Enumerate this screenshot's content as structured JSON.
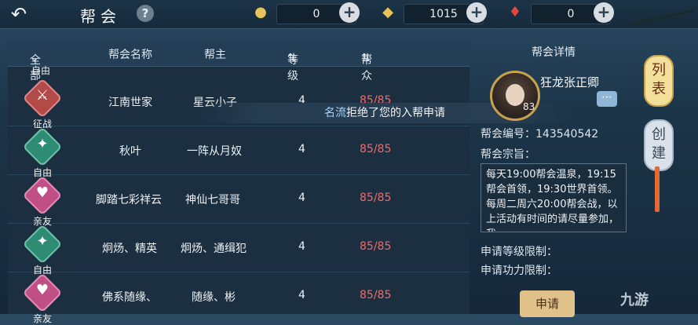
{
  "topbar": {
    "title": "帮会",
    "help": "?",
    "resources": [
      {
        "icon": "gold-ingot-icon",
        "value": "0"
      },
      {
        "icon": "gold-coin-pile-icon",
        "value": "1015"
      },
      {
        "icon": "red-pouch-icon",
        "value": "0"
      }
    ]
  },
  "list": {
    "headers": {
      "all": "全部",
      "name": "帮会名称",
      "leader": "帮主",
      "level": "等级",
      "members": "帮众"
    },
    "partial_tag": "自由",
    "rows": [
      {
        "emblem": "red",
        "tag": "征战",
        "name": "江南世家",
        "leader": "星云小子",
        "level": "4",
        "members": "85/85"
      },
      {
        "emblem": "green",
        "tag": "自由",
        "name": "秋叶",
        "leader": "一阵从月奴",
        "level": "4",
        "members": "85/85"
      },
      {
        "emblem": "pink",
        "tag": "亲友",
        "name": "脚踏七彩祥云",
        "leader": "神仙七哥哥",
        "level": "4",
        "members": "85/85"
      },
      {
        "emblem": "green",
        "tag": "自由",
        "name": "炯炀、精英",
        "leader": "炯炀、通缉犯",
        "level": "4",
        "members": "85/85"
      },
      {
        "emblem": "pink",
        "tag": "亲友",
        "name": "佛系随缘、",
        "leader": "随缘、彬",
        "level": "4",
        "members": "85/85"
      }
    ]
  },
  "notice": {
    "name": "名流",
    "text": "拒绝了您的入帮申请"
  },
  "detail": {
    "title": "帮会详情",
    "leader_name": "狂龙张正卿",
    "leader_level": "83",
    "id_label": "帮会编号：",
    "id_value": "143540542",
    "motto_label": "帮会宗旨：",
    "motto": "每天19:00帮会温泉，19:15帮会首领，19:30世界首领。每周二周六20:00帮会战，以上活动有时间的请尽量参加，我",
    "level_limit_label": "申请等级限制：",
    "power_limit_label": "申请功力限制：",
    "apply_button": "申请"
  },
  "tabs": {
    "list": "列表",
    "create": "创建"
  },
  "watermark": "九游"
}
